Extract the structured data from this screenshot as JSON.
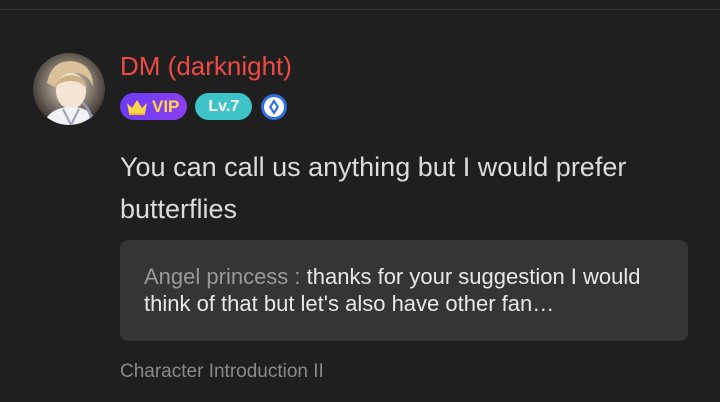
{
  "comment": {
    "username": "DM (darknight)",
    "badges": {
      "vip_label": "VIP",
      "vip_icon": "crown-icon",
      "level_label": "Lv.7",
      "cert_icon": "certification-icon"
    },
    "text": "You can call us anything but I would prefer butterflies",
    "reply": {
      "author": "Angel princess :",
      "text": "thanks for your suggestion I would think of that but let's also have other fan…"
    },
    "context": "Character Introduction II"
  },
  "colors": {
    "background": "#1f1f1f",
    "username": "#ef4a43",
    "vip_badge": "#7a3df3",
    "level_badge": "#3ec4c8",
    "reply_box": "#353535"
  }
}
